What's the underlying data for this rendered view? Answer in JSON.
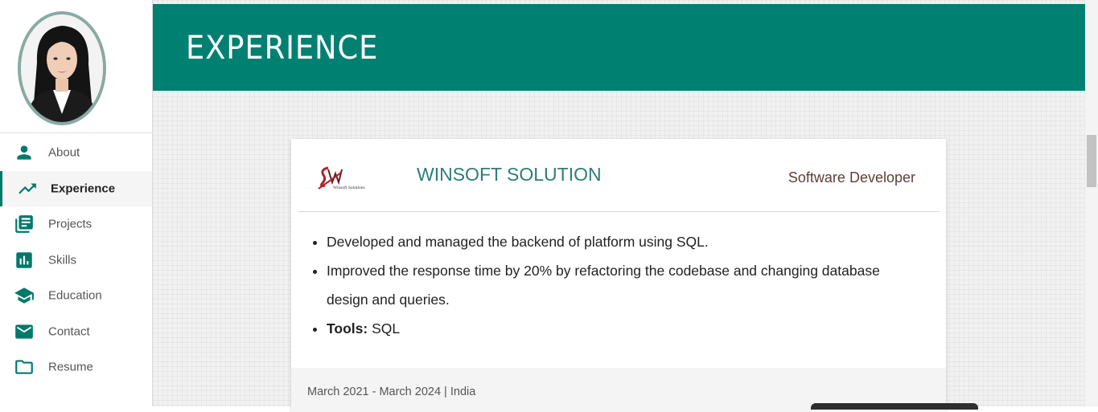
{
  "sidebar": {
    "items": [
      {
        "label": "About",
        "icon": "person-icon"
      },
      {
        "label": "Experience",
        "icon": "trending-up-icon"
      },
      {
        "label": "Projects",
        "icon": "library-books-icon"
      },
      {
        "label": "Skills",
        "icon": "bar-chart-icon"
      },
      {
        "label": "Education",
        "icon": "school-icon"
      },
      {
        "label": "Contact",
        "icon": "email-icon"
      },
      {
        "label": "Resume",
        "icon": "folder-icon"
      }
    ],
    "active": "Experience"
  },
  "header": {
    "title": "EXPERIENCE"
  },
  "experience": {
    "company": "WINSOFT SOLUTION",
    "logo_text": "Winsoft Solutions",
    "role": "Software Developer",
    "bullets": [
      "Developed and managed the backend of platform using SQL.",
      "Improved the response time by 20% by refactoring the codebase and changing database design and queries."
    ],
    "tools_label": "Tools:",
    "tools_value": " SQL",
    "footer": "March 2021 - March 2024 | India"
  },
  "colors": {
    "accent": "#008071",
    "company_name": "#2d7d78",
    "role": "#5d4037"
  }
}
